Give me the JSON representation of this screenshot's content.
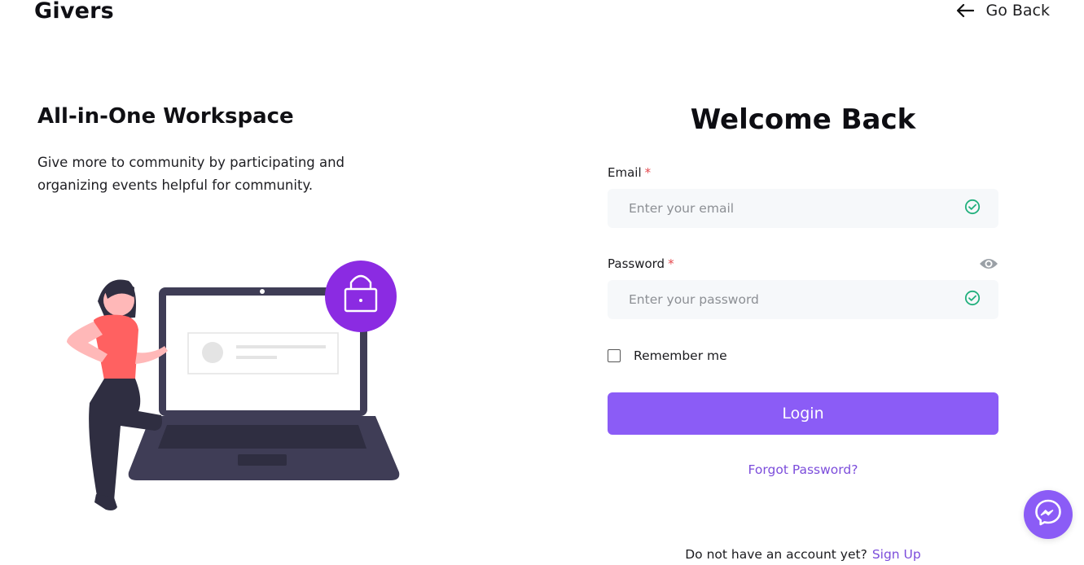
{
  "header": {
    "brand": "Givers",
    "go_back_label": "Go Back"
  },
  "hero": {
    "title": "All-in-One Workspace",
    "subtitle": "Give more to community by participating and organizing events helpful for community."
  },
  "login": {
    "title": "Welcome Back",
    "email_label": "Email",
    "email_placeholder": "Enter your email",
    "email_value": "",
    "password_label": "Password",
    "password_placeholder": "Enter your password",
    "password_value": "",
    "required_mark": "*",
    "remember_label": "Remember me",
    "remember_checked": false,
    "login_button": "Login",
    "forgot_link": "Forgot Password?",
    "no_account_text": "Do not have an account yet?",
    "signup_link": "Sign Up"
  },
  "colors": {
    "accent": "#8b5cf6",
    "link": "#7c4ddb",
    "valid_check": "#22b07d",
    "required": "#e5484d"
  },
  "icons": {
    "go_back": "arrow-left-icon",
    "email_status": "check-circle-icon",
    "password_status": "check-circle-icon",
    "password_toggle": "eye-icon",
    "chat": "messenger-icon",
    "lock": "lock-icon"
  }
}
